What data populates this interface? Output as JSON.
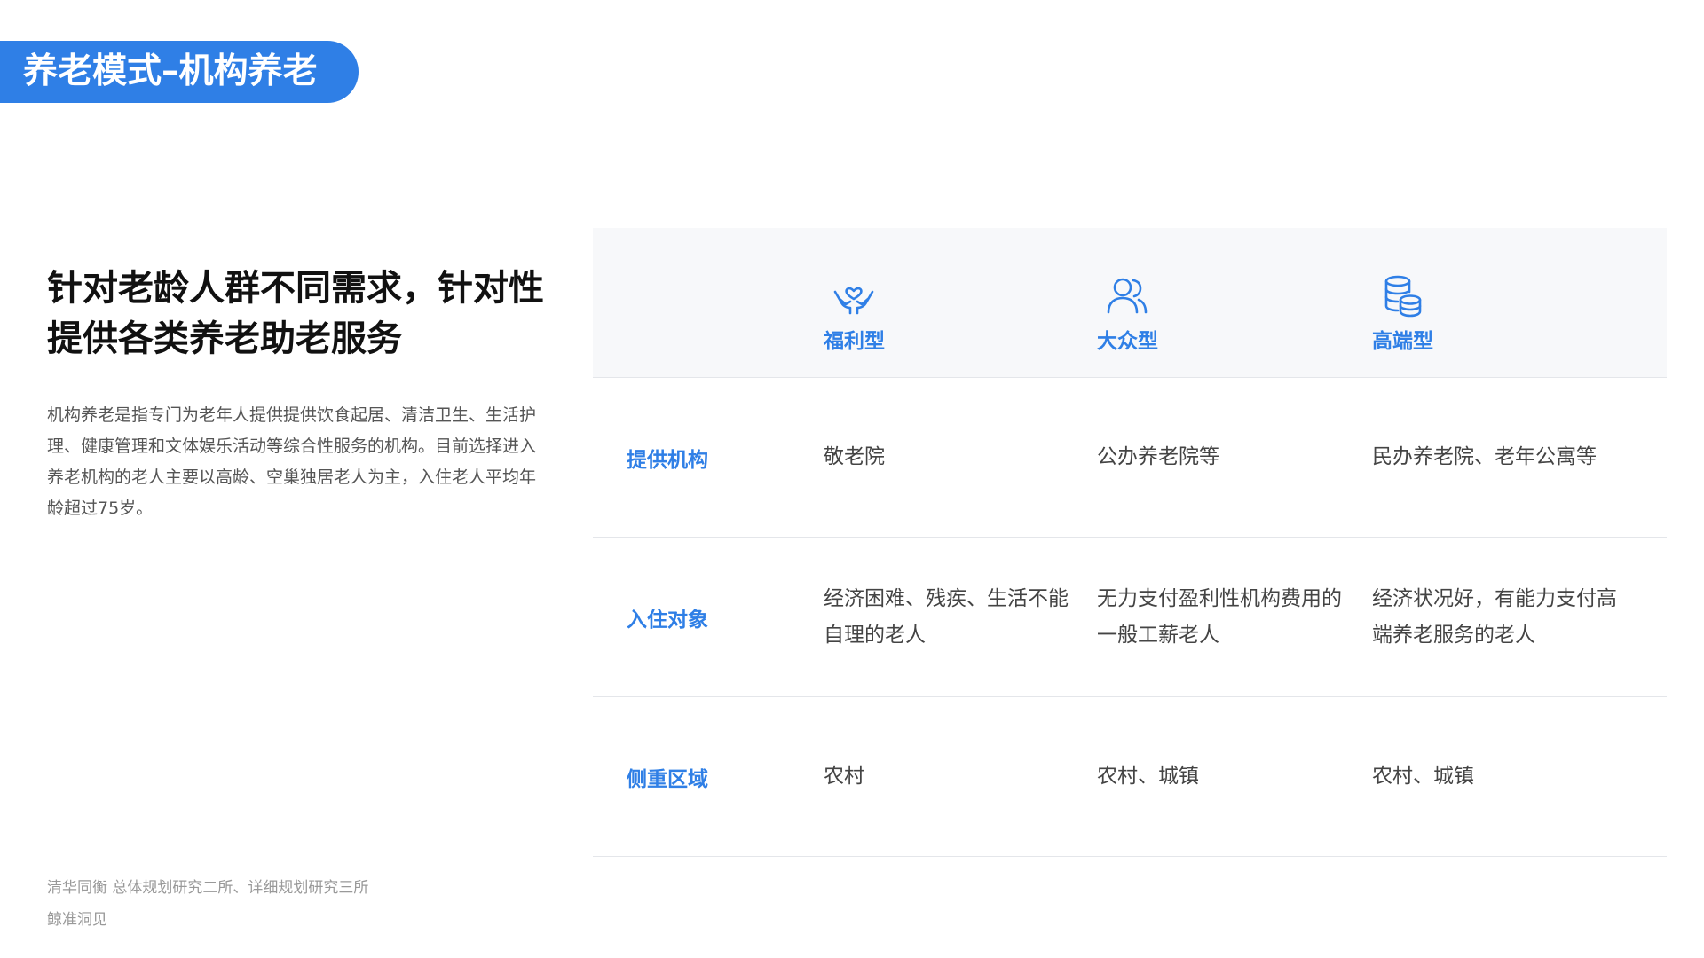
{
  "slide": {
    "title": "养老模式–机构养老",
    "headline": "针对老龄人群不同需求，针对性提供各类养老助老服务",
    "description": "机构养老是指专门为老年人提供提供饮食起居、清洁卫生、生活护理、健康管理和文体娱乐活动等综合性服务的机构。目前选择进入养老机构的老人主要以高龄、空巢独居老人为主，入住老人平均年龄超过75岁。",
    "source_line1": "清华同衡 总体规划研究二所、详细规划研究三所",
    "source_line2": "鲸准洞见"
  },
  "table": {
    "accent_color": "#2f7fe6",
    "types": [
      {
        "label": "福利型",
        "icon": "heart-in-hands-icon"
      },
      {
        "label": "大众型",
        "icon": "users-icon"
      },
      {
        "label": "高端型",
        "icon": "coin-stack-icon"
      }
    ],
    "rows": [
      {
        "label": "提供机构",
        "cells": [
          "敬老院",
          "公办养老院等",
          "民办养老院、老年公寓等"
        ]
      },
      {
        "label": "入住对象",
        "cells": [
          "经济困难、残疾、生活不能自理的老人",
          "无力支付盈利性机构费用的一般工薪老人",
          "经济状况好，有能力支付高端养老服务的老人"
        ]
      },
      {
        "label": "侧重区域",
        "cells": [
          "农村",
          "农村、城镇",
          "农村、城镇"
        ]
      }
    ]
  }
}
